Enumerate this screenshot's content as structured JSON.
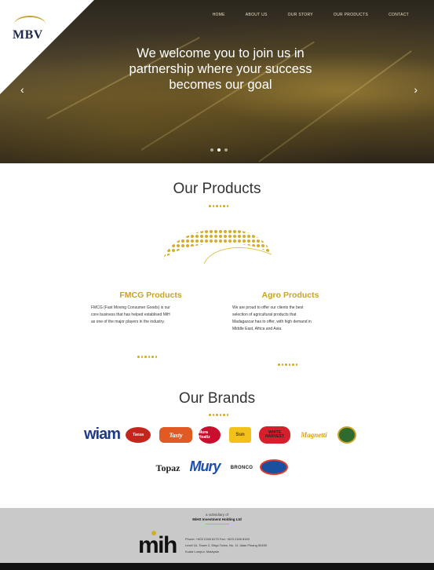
{
  "nav": {
    "items": [
      "HOME",
      "ABOUT US",
      "OUR STORY",
      "OUR PRODUCTS",
      "CONTACT"
    ]
  },
  "logo": {
    "text": "MBV"
  },
  "hero": {
    "title_lines": [
      "We welcome you to join us in",
      "partnership where your success",
      "becomes our goal"
    ],
    "prev_icon": "‹",
    "next_icon": "›",
    "slide_count": 3,
    "active_slide": 2
  },
  "products": {
    "title": "Our Products",
    "columns": [
      {
        "title": "FMCG Products",
        "text_lines": [
          "FMCG (Fast Moving Consumer Goods) is our",
          "core business that has helped establised MiH",
          "as one of the major players in the industry."
        ]
      },
      {
        "title": "Agro Products",
        "text_lines": [
          "We are proud to offer our clients the best",
          "selection of agricultural products that",
          "Madagascar has to offer, with high demand in",
          "Middle East, Africa and Asia."
        ]
      }
    ]
  },
  "brands": {
    "title": "Our Brands",
    "row1": [
      "wiam",
      "Tanza",
      "Tasty",
      "Mura Healtz",
      "Sun",
      "WHITE HARVEST",
      "Magnetti",
      ""
    ],
    "row2": [
      "Topaz",
      "Mury",
      "BRONCO",
      ""
    ]
  },
  "footer": {
    "subsidiary": "a subsidiary of",
    "holding": "MiHS Investment Holding Ltd",
    "logo": "mih",
    "address_lines": [
      "Phone: +603 2166 8170 Fax: +603 2166 8169",
      "Level 16, Tower 2, Etiqa Twins, No. 11 Jalan Pinang 50450",
      "Kuala Lumpur, Malaysia"
    ]
  },
  "colors": {
    "accent": "#c9a227",
    "footer_bg": "#c9c9c9"
  }
}
